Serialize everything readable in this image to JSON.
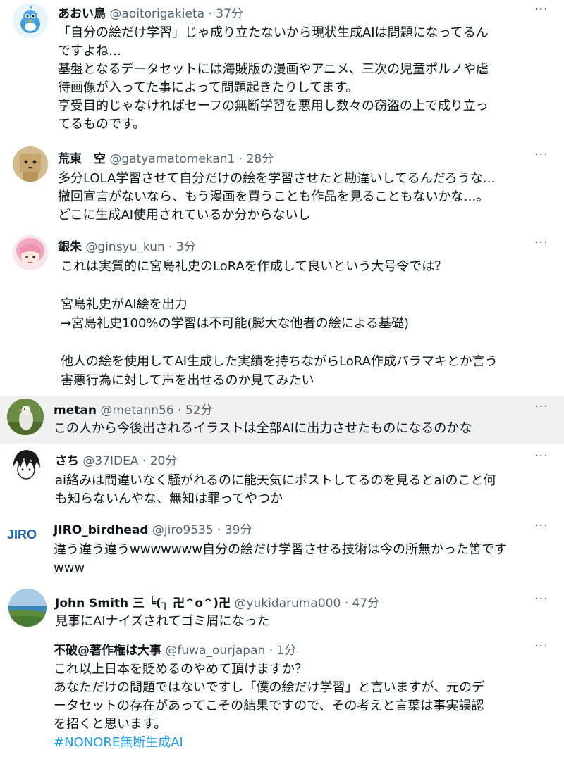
{
  "more_glyph": "···",
  "tweets": [
    {
      "name": "あおい鳥",
      "handle": "@aoitorigakieta",
      "time": "· 37分",
      "avatar_icon": "blue-bird-icon",
      "lines": [
        "「自分の絵だけ学習」じゃ成り立たないから現状生成AIは問題になってるん",
        "ですよね…",
        "基盤となるデータセットには海賊版の漫画やアニメ、三次の児童ポルノや虐",
        "待画像が入ってた事によって問題起きたりしてます。",
        "享受目的じゃなければセーフの無断学習を悪用し数々の窃盗の上で成り立っ",
        "てるものです。"
      ]
    },
    {
      "name": "荒東　空",
      "handle": "@gatyamatomekan1",
      "time": "· 28分",
      "avatar_icon": "cardboard-robot-icon",
      "lines": [
        "多分LOLA学習させて自分だけの絵を学習させたと勘違いしてるんだろうな…",
        "撤回宣言がないなら、もう漫画を買うことも作品を見ることもないかな…。",
        "どこに生成AI使用されているか分からないし"
      ]
    },
    {
      "name": "銀朱",
      "handle": "@ginsyu_kun",
      "time": "· 3分",
      "avatar_icon": "pink-hair-character-icon",
      "lines": [
        "これは実質的に宮島礼史のLoRAを作成して良いという大号令では？",
        "",
        "宮島礼史がAI絵を出力",
        "→宮島礼史100%の学習は不可能(膨大な他者の絵による基礎)",
        "",
        "他人の絵を使用してAI生成した実績を持ちながらLoRA作成バラマキとか言う",
        "害悪行為に対して声を出せるのか見てみたい"
      ]
    },
    {
      "name": "metan",
      "handle": "@metann56",
      "time": "· 52分",
      "avatar_icon": "bird-photo-icon",
      "lines": [
        "この人から今後出されるイラストは全部AIに出力させたものになるのかな"
      ]
    },
    {
      "name": "さち",
      "handle": "@37IDEA",
      "time": "· 20分",
      "avatar_icon": "sketch-face-icon",
      "lines": [
        "ai絡みは間違いなく騒がれるのに能天気にポストしてるのを見るとaiのこと何",
        "も知らないんやな、無知は罪ってやつか"
      ]
    },
    {
      "name": "JIRO_birdhead",
      "handle": "@jiro9535",
      "time": "· 39分",
      "avatar_icon": "jiro-logo-icon",
      "avatar_text": "JIRO",
      "lines": [
        "違う違う違うwwwwwww自分の絵だけ学習させる技術は今の所無かった筈です",
        "www"
      ]
    },
    {
      "name": "John Smith 三 ╘(┐ 卍^o^)卍",
      "handle": "@yukidaruma000",
      "time": "· 47分",
      "avatar_icon": "coast-landscape-icon",
      "lines": [
        "見事にAIナイズされてゴミ屑になった"
      ]
    },
    {
      "name": "不破@著作権は大事",
      "handle": "@fuwa_ourjapan",
      "time": "· 1分",
      "avatar_icon": "",
      "lines": [
        "これ以上日本を貶めるのやめて頂けますか？",
        "あなただけの問題ではないですし「僕の絵だけ学習」と言いますが、元のデ",
        "ータセットの存在があってこその結果ですので、その考えと言葉は事実誤認",
        "を招くと思います。"
      ],
      "hashtag": "#NONORE無断生成AI"
    }
  ]
}
